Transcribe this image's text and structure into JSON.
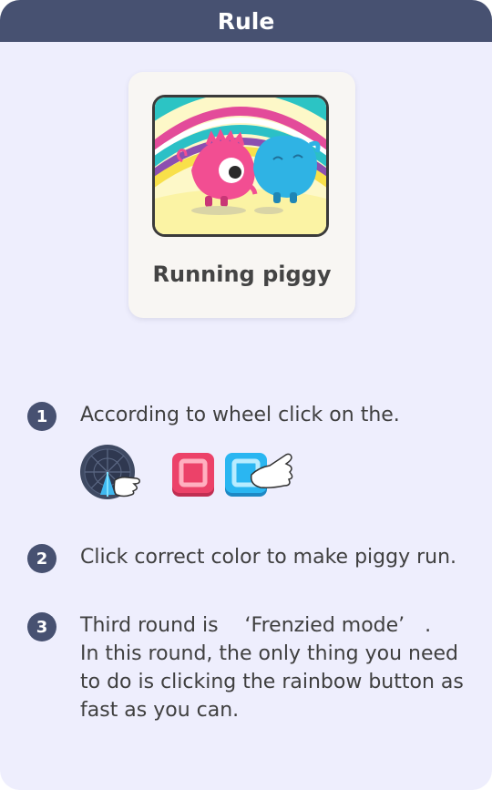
{
  "header": {
    "title": "Rule"
  },
  "game": {
    "name": "Running piggy"
  },
  "steps": [
    {
      "number": "1",
      "text": "According to wheel click on the."
    },
    {
      "number": "2",
      "text": "Click correct color to make piggy run."
    },
    {
      "number": "3",
      "lines": [
        "Third round is 　‘Frenzied mode’　.",
        "In this round, the only thing you need",
        "to do is clicking the rainbow button as",
        "fast as you can."
      ]
    }
  ],
  "icons": [
    "wheel-icon",
    "pointing-hand-icon",
    "red-square-button-icon",
    "blue-square-button-icon"
  ],
  "colors": {
    "header": "#475171",
    "panel": "#eeeefd",
    "red_button": "#e83b63",
    "blue_button": "#2ab2ee"
  }
}
